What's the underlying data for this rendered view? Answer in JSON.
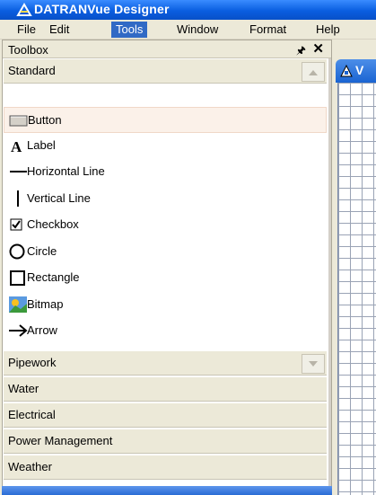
{
  "window": {
    "title": "DATRANVue Designer"
  },
  "menu": {
    "items": [
      {
        "label": "File",
        "active": false
      },
      {
        "label": "Edit",
        "active": false
      },
      {
        "label": "Tools",
        "active": true
      },
      {
        "label": "Window",
        "active": false
      },
      {
        "label": "Format",
        "active": false
      },
      {
        "label": "Help",
        "active": false
      }
    ]
  },
  "toolbox": {
    "title": "Toolbox",
    "pin_icon": "pin-icon",
    "close_icon": "close-icon",
    "expanded_category": {
      "label": "Standard",
      "arrow": "chevron-up"
    },
    "tools": [
      {
        "label": "Button",
        "icon": "button-icon",
        "selected": true
      },
      {
        "label": "Label",
        "icon": "label-icon",
        "selected": false
      },
      {
        "label": "Horizontal Line",
        "icon": "horizontal-line-icon",
        "selected": false
      },
      {
        "label": "Vertical Line",
        "icon": "vertical-line-icon",
        "selected": false
      },
      {
        "label": "Checkbox",
        "icon": "checkbox-icon",
        "selected": false
      },
      {
        "label": "Circle",
        "icon": "circle-icon",
        "selected": false
      },
      {
        "label": "Rectangle",
        "icon": "rectangle-icon",
        "selected": false
      },
      {
        "label": "Bitmap",
        "icon": "bitmap-icon",
        "selected": false
      },
      {
        "label": "Arrow",
        "icon": "arrow-icon",
        "selected": false
      }
    ],
    "collapsed_categories": [
      {
        "label": "Pipework",
        "arrow": "chevron-down"
      },
      {
        "label": "Water"
      },
      {
        "label": "Electrical"
      },
      {
        "label": "Power Management"
      },
      {
        "label": "Weather"
      }
    ]
  },
  "document_tab": {
    "label": "V"
  },
  "colors": {
    "titlebar": "#0a5ee0",
    "menu_active": "#316ac5",
    "selected_item": "#fbf1e9",
    "grid": "#9aa3b5"
  }
}
